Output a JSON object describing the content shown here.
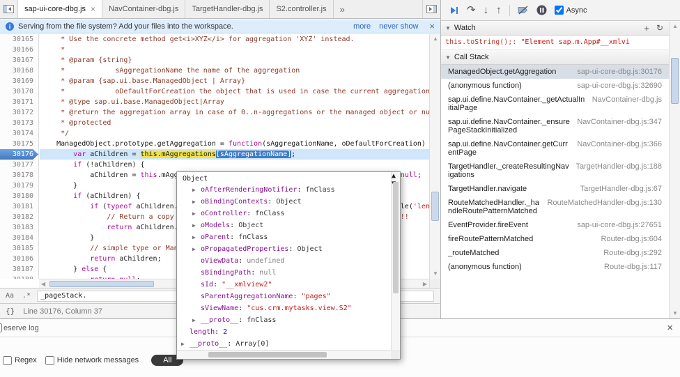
{
  "icons": {
    "chevron_more": "»",
    "close": "×",
    "info": "i",
    "tri_down": "▼",
    "plus": "+",
    "refresh": "↻",
    "step_over": "↷",
    "step_into": "↓",
    "step_out": "↑",
    "scroll_up": "▲",
    "scroll_down": "▼",
    "scroll_left": "◀",
    "scroll_right": "▶",
    "expand": "▶",
    "case_btn": "Aa",
    "regex_btn": ".*",
    "pretty_print": "{}"
  },
  "tabbar": {
    "tabs": [
      {
        "label": "sap-ui-core-dbg.js",
        "active": true,
        "closable": true
      },
      {
        "label": "NavContainer-dbg.js"
      },
      {
        "label": "TargetHandler-dbg.js"
      },
      {
        "label": "S2.controller.js"
      }
    ]
  },
  "infobar": {
    "text": "Serving from the file system? Add your files into the workspace.",
    "more_link": "more",
    "never_link": "never show"
  },
  "editor": {
    "lines": [
      {
        "num": 30165,
        "type": "comment",
        "text": "\t * Use the concrete method get<i>XYZ</i> for aggregation 'XYZ' instead."
      },
      {
        "num": 30166,
        "type": "comment",
        "text": "\t *"
      },
      {
        "num": 30167,
        "type": "comment",
        "text": "\t * @param {string}"
      },
      {
        "num": 30168,
        "type": "comment",
        "text": "\t *            sAggregationName the name of the aggregation"
      },
      {
        "num": 30169,
        "type": "comment",
        "text": "\t * @param {sap.ui.base.ManagedObject | Array}"
      },
      {
        "num": 30170,
        "type": "comment",
        "text": "\t *            oDefaultForCreation the object that is used in case the current aggregation is empty"
      },
      {
        "num": 30171,
        "type": "comment",
        "text": "\t * @type sap.ui.base.ManagedObject|Array"
      },
      {
        "num": 30172,
        "type": "comment",
        "text": "\t * @return the aggregation array in case of 0..n-aggregations or the managed object or null"
      },
      {
        "num": 30173,
        "type": "comment",
        "text": "\t * @protected"
      },
      {
        "num": 30174,
        "type": "comment",
        "text": "\t */"
      },
      {
        "num": 30175,
        "type": "code",
        "text": "\tManagedObject.prototype.getAggregation = function(sAggregationName, oDefaultForCreation) {"
      },
      {
        "num": 30176,
        "type": "code",
        "exec": true,
        "bp": true,
        "segments": [
          {
            "t": "\t\tvar aChildren = "
          },
          {
            "t": "this.mAggregations",
            "c": "tok-y"
          },
          {
            "t": "[sAggregationName]",
            "c": "tok-b"
          },
          {
            "t": ";"
          }
        ]
      },
      {
        "num": 30177,
        "type": "code",
        "text": "\t\tif (!aChildren) {"
      },
      {
        "num": 30178,
        "type": "code",
        "text": "\t\t\taChildren = this.mAggregations[sAggregationName] = oDefaultForCreation || null;"
      },
      {
        "num": 30179,
        "type": "code",
        "text": "\t\t}"
      },
      {
        "num": 30180,
        "type": "code",
        "text": "\t\tif (aChildren) {"
      },
      {
        "num": 30181,
        "type": "code",
        "text": "\t\t\tif (typeof aChildren.length === 'number' && !(aChildren.propertyIsEnumerable('length'))) {"
      },
      {
        "num": 30182,
        "type": "comment",
        "text": "\t\t\t\t// Return a copy of the array instead of the array itself as reference!!"
      },
      {
        "num": 30183,
        "type": "code",
        "text": "\t\t\t\treturn aChildren.slice();"
      },
      {
        "num": 30184,
        "type": "code",
        "text": "\t\t\t}"
      },
      {
        "num": 30185,
        "type": "comment",
        "text": "\t\t\t// simple type or ManagedObject"
      },
      {
        "num": 30186,
        "type": "code",
        "text": "\t\t\treturn aChildren;"
      },
      {
        "num": 30187,
        "type": "code",
        "text": "\t\t} else {"
      },
      {
        "num": 30188,
        "type": "code",
        "text": "\t\t\treturn null;"
      }
    ]
  },
  "search_bar": {
    "query": "_pageStack."
  },
  "status_bar": {
    "position": "Line 30176, Column 37"
  },
  "drawer": {
    "preserve_fragment": "eserve log",
    "regex_label": "Regex",
    "hide_network_label": "Hide network messages",
    "filter_all": "All"
  },
  "sidebar": {
    "toolbar": {
      "async_label": "Async"
    },
    "watch": {
      "title": "Watch",
      "expression": "this.toString();:",
      "value": "\"Element sap.m.App#__xmlvi"
    },
    "callstack": {
      "title": "Call Stack",
      "frames": [
        {
          "name": "ManagedObject.getAggregation",
          "loc": "sap-ui-core-dbg.js:30176",
          "selected": true
        },
        {
          "name": "(anonymous function)",
          "loc": "sap-ui-core-dbg.js:32690"
        },
        {
          "name": "sap.ui.define.NavContainer._getActualInitialPage",
          "loc": "NavContainer-dbg.js"
        },
        {
          "name": "sap.ui.define.NavContainer._ensurePageStackInitialized",
          "loc": "NavContainer-dbg.js:347"
        },
        {
          "name": "sap.ui.define.NavContainer.getCurrentPage",
          "loc": "NavContainer-dbg.js:366"
        },
        {
          "name": "TargetHandler._createResultingNavigations",
          "loc": "TargetHandler-dbg.js:188"
        },
        {
          "name": "TargetHandler.navigate",
          "loc": "TargetHandler-dbg.js:67"
        },
        {
          "name": "RouteMatchedHandler._handleRoutePatternMatched",
          "loc": "RouteMatchedHandler-dbg.js:130"
        },
        {
          "name": "EventProvider.fireEvent",
          "loc": "sap-ui-core-dbg.js:27651"
        },
        {
          "name": "fireRoutePatternMatched",
          "loc": "Router-dbg.js:604"
        },
        {
          "name": "_routeMatched",
          "loc": "Route-dbg.js:292"
        },
        {
          "name": "(anonymous function)",
          "loc": "Route-dbg.js:117"
        }
      ]
    }
  },
  "popup": {
    "title": "Object",
    "props": [
      {
        "arrow": true,
        "name": "oAfterRenderingNotifier",
        "value": "fnClass",
        "type": "obj"
      },
      {
        "arrow": true,
        "name": "oBindingContexts",
        "value": "Object",
        "type": "obj"
      },
      {
        "arrow": true,
        "name": "oController",
        "value": "fnClass",
        "type": "obj"
      },
      {
        "arrow": true,
        "name": "oModels",
        "value": "Object",
        "type": "obj"
      },
      {
        "arrow": true,
        "name": "oParent",
        "value": "fnClass",
        "type": "obj"
      },
      {
        "arrow": true,
        "name": "oPropagatedProperties",
        "value": "Object",
        "type": "obj"
      },
      {
        "arrow": false,
        "name": "oViewData",
        "value": "undefined",
        "type": "undef"
      },
      {
        "arrow": false,
        "name": "sBindingPath",
        "value": "null",
        "type": "undef"
      },
      {
        "arrow": false,
        "name": "sId",
        "value": "\"__xmlview2\"",
        "type": "str"
      },
      {
        "arrow": false,
        "name": "sParentAggregationName",
        "value": "\"pages\"",
        "type": "str"
      },
      {
        "arrow": false,
        "name": "sViewName",
        "value": "\"cus.crm.mytasks.view.S2\"",
        "type": "str"
      },
      {
        "arrow": true,
        "name": "__proto__",
        "value": "fnClass",
        "type": "obj"
      }
    ],
    "footer": [
      {
        "arrow": false,
        "name": "length",
        "value": "2",
        "type": "num"
      },
      {
        "arrow": true,
        "name": "__proto__",
        "value": "Array[0]",
        "type": "obj"
      }
    ]
  },
  "colors": {
    "accent_blue": "#3879d9",
    "exec_line_bg": "#cfe6fb",
    "token_yellow": "#f3e245",
    "selection_blue": "#3f7cc7",
    "string_red": "#c41a16",
    "property_purple": "#881391",
    "comment": "#8a3b2a",
    "keyword": "#aa0d91"
  }
}
